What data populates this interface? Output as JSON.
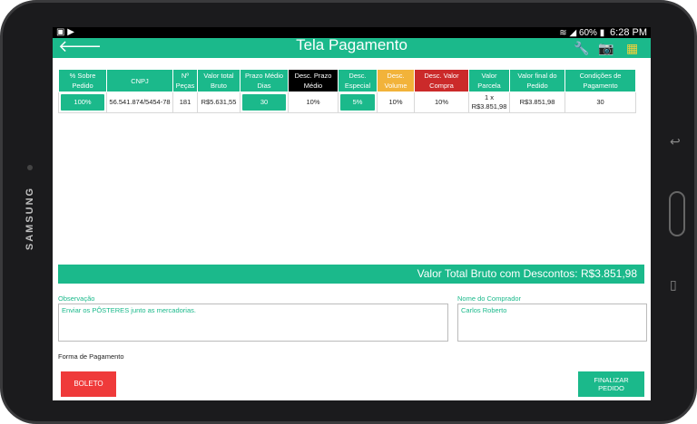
{
  "device": {
    "brand": "SAMSUNG"
  },
  "status": {
    "battery": "60%",
    "time": "6:28 PM"
  },
  "appbar": {
    "title": "Tela Pagamento"
  },
  "table": {
    "headers": [
      [
        "% Sobre",
        "Pedido"
      ],
      [
        "CNPJ",
        ""
      ],
      [
        "Nº",
        "Peças"
      ],
      [
        "Valor total",
        "Bruto"
      ],
      [
        "Prazo Médio",
        "Dias"
      ],
      [
        "Desc. Prazo",
        "Médio"
      ],
      [
        "Desc.",
        "Especial"
      ],
      [
        "Desc.",
        "Volume"
      ],
      [
        "Desc. Valor",
        "Compra"
      ],
      [
        "Valor",
        "Parcela"
      ],
      [
        "Valor final do",
        "Pedido"
      ],
      [
        "Condições de",
        "Pagamento"
      ]
    ],
    "row": {
      "sobre_pedido": "100%",
      "cnpj": "56.541.874/5454-78",
      "pecas": "181",
      "valor_bruto": "R$5.631,55",
      "prazo_medio": "30",
      "desc_prazo": "10%",
      "desc_especial": "5%",
      "desc_volume": "10%",
      "desc_valor_compra": "10%",
      "valor_parcela_1": "1 x",
      "valor_parcela_2": "R$3.851,98",
      "valor_final": "R$3.851,98",
      "condicoes": "30"
    }
  },
  "total": {
    "text": "Valor Total Bruto com Descontos: R$3.851,98"
  },
  "observacao": {
    "label": "Observação",
    "value": "Enviar os PÔSTERES junto as mercadorias."
  },
  "comprador": {
    "label": "Nome do Comprador",
    "value": "Carlos Roberto"
  },
  "forma_pagamento": {
    "label": "Forma de Pagamento"
  },
  "buttons": {
    "boleto": "BOLETO",
    "finalizar_1": "FINALIZAR",
    "finalizar_2": "PEDIDO"
  },
  "colors": {
    "primary": "#1bb98b",
    "red": "#ef3a3a",
    "yellow": "#f2b33a",
    "dark_red": "#cb2a2a",
    "black": "#000000"
  },
  "icons": [
    "back-arrow-icon",
    "wrench-icon",
    "camera-icon",
    "calendar-grid-icon",
    "wifi-icon",
    "signal-icon",
    "battery-icon"
  ]
}
